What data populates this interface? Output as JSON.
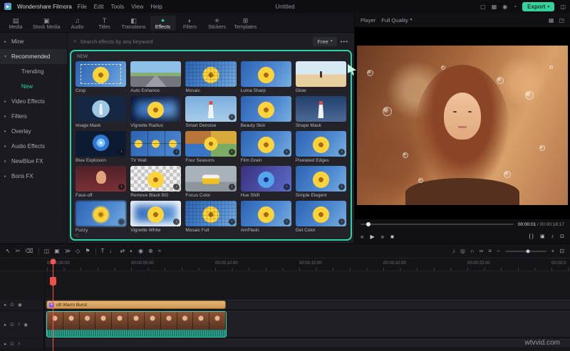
{
  "titlebar": {
    "app_name": "Wondershare Filmora",
    "menus": [
      "File",
      "Edit",
      "Tools",
      "View",
      "Help"
    ],
    "document_title": "Untitled",
    "right_icons": [
      {
        "name": "screen-recorder-icon",
        "glyph": "▢"
      },
      {
        "name": "layout-icon",
        "glyph": "▦"
      },
      {
        "name": "user-account-icon",
        "glyph": "◉"
      },
      {
        "name": "notification-icon",
        "glyph": "◔"
      }
    ],
    "export_label": "Export",
    "export_caret": "▾",
    "panel_toggle_icon": "◫",
    "logo_glyph": "▶"
  },
  "ribbon": {
    "tabs": [
      {
        "label": "Media",
        "icon": "▤",
        "active": false
      },
      {
        "label": "Stock Media",
        "icon": "▣",
        "active": false
      },
      {
        "label": "Audio",
        "icon": "♫",
        "active": false
      },
      {
        "label": "Titles",
        "icon": "T",
        "active": false
      },
      {
        "label": "Transitions",
        "icon": "◧",
        "active": false
      },
      {
        "label": "Effects",
        "icon": "✦",
        "active": true
      },
      {
        "label": "Filters",
        "icon": "◐",
        "active": false
      },
      {
        "label": "Stickers",
        "icon": "✳",
        "active": false
      },
      {
        "label": "Templates",
        "icon": "⊞",
        "active": false
      }
    ]
  },
  "sidebar": {
    "items": [
      {
        "label": "Mine",
        "level": 0,
        "chevron": "right",
        "active": false,
        "accent": false
      },
      {
        "label": "Recommended",
        "level": 0,
        "chevron": "down",
        "active": true,
        "accent": false
      },
      {
        "label": "Trending",
        "level": 1,
        "chevron": "none",
        "active": false,
        "accent": false
      },
      {
        "label": "New",
        "level": 1,
        "chevron": "none",
        "active": false,
        "accent": true
      },
      {
        "label": "Video Effects",
        "level": 0,
        "chevron": "right",
        "active": false,
        "accent": false
      },
      {
        "label": "Filters",
        "level": 0,
        "chevron": "right",
        "active": false,
        "accent": false
      },
      {
        "label": "Overlay",
        "level": 0,
        "chevron": "right",
        "active": false,
        "accent": false
      },
      {
        "label": "Audio Effects",
        "level": 0,
        "chevron": "right",
        "active": false,
        "accent": false
      },
      {
        "label": "NewBlue FX",
        "level": 0,
        "chevron": "right",
        "active": false,
        "accent": false
      },
      {
        "label": "Boris FX",
        "level": 0,
        "chevron": "right",
        "active": false,
        "accent": false
      }
    ]
  },
  "search": {
    "placeholder": "Search effects by any keyword",
    "filter_label": "Free",
    "more_label": "•••"
  },
  "effects": {
    "section_label": "NEW",
    "items": [
      {
        "label": "Crop",
        "visual": "crop",
        "badge": "none"
      },
      {
        "label": "Auto Enhance",
        "visual": "road",
        "badge": "none"
      },
      {
        "label": "Mosaic",
        "visual": "mosaic",
        "badge": "none"
      },
      {
        "label": "Luma Sharp",
        "visual": "flower",
        "badge": "none"
      },
      {
        "label": "Glow",
        "visual": "beach",
        "badge": "none"
      },
      {
        "label": "Image Mask",
        "visual": "mask",
        "badge": "none"
      },
      {
        "label": "Vignette Radius",
        "visual": "flower-vignette",
        "badge": "none"
      },
      {
        "label": "Smart Denoise",
        "visual": "lighthouse",
        "badge": "download"
      },
      {
        "label": "Beauty Skin",
        "visual": "flower",
        "badge": "none"
      },
      {
        "label": "Shape Mask",
        "visual": "lighthouse2",
        "badge": "none"
      },
      {
        "label": "Blue Explosion",
        "visual": "explosion",
        "badge": "download"
      },
      {
        "label": "TV Wall",
        "visual": "tvwall",
        "badge": "download"
      },
      {
        "label": "Four Seasons",
        "visual": "seasons",
        "badge": "download"
      },
      {
        "label": "Film Grain",
        "visual": "flower",
        "badge": "download"
      },
      {
        "label": "Pixelated Edges",
        "visual": "flower",
        "badge": "download"
      },
      {
        "label": "Face-off",
        "visual": "face",
        "badge": "download"
      },
      {
        "label": "Remove Black BG",
        "visual": "checker",
        "badge": "download"
      },
      {
        "label": "Focus Color",
        "visual": "bus",
        "badge": "download"
      },
      {
        "label": "Hue Shift",
        "visual": "hue",
        "badge": "download"
      },
      {
        "label": "Simple Elegent",
        "visual": "flower",
        "badge": "download"
      },
      {
        "label": "Fuzzy",
        "visual": "flower-blur",
        "badge": "download"
      },
      {
        "label": "Vignette White",
        "visual": "flower-white",
        "badge": "download"
      },
      {
        "label": "Mosaic Full",
        "visual": "mosaic",
        "badge": "download"
      },
      {
        "label": "AmPlash",
        "visual": "flower",
        "badge": "download"
      },
      {
        "label": "Get Color",
        "visual": "flower",
        "badge": "download"
      }
    ]
  },
  "player": {
    "label": "Player",
    "quality_label": "Full Quality",
    "quality_caret": "▾",
    "top_icons": [
      {
        "name": "grid-view-icon",
        "glyph": "▦"
      },
      {
        "name": "detach-window-icon",
        "glyph": "◳"
      }
    ],
    "current_time": "00:00:01",
    "time_separator": "/",
    "total_time": "00:00:18:17",
    "transport": [
      {
        "name": "previous-frame-button",
        "glyph": "«"
      },
      {
        "name": "play-button",
        "glyph": "▶"
      },
      {
        "name": "next-frame-button",
        "glyph": "»"
      },
      {
        "name": "stop-button",
        "glyph": "■"
      }
    ],
    "tools": [
      {
        "name": "mark-in-out-icon",
        "glyph": "{ }"
      },
      {
        "name": "snapshot-icon",
        "glyph": "▣"
      },
      {
        "name": "volume-icon",
        "glyph": "♪"
      },
      {
        "name": "fullscreen-icon",
        "glyph": "⊡"
      }
    ]
  },
  "timeline": {
    "tools_left": [
      {
        "name": "pointer-tool-icon",
        "glyph": "↖"
      },
      {
        "name": "razor-tool-icon",
        "glyph": "✂"
      },
      {
        "name": "delete-icon",
        "glyph": "⌫"
      },
      {
        "sep": true
      },
      {
        "name": "split-icon",
        "glyph": "◫"
      },
      {
        "name": "crop-icon",
        "glyph": "▣"
      },
      {
        "name": "speed-icon",
        "glyph": "≫"
      },
      {
        "name": "keyframe-icon",
        "glyph": "◇"
      },
      {
        "name": "marker-icon",
        "glyph": "⚑"
      },
      {
        "sep": true
      },
      {
        "name": "text-tool-icon",
        "glyph": "T"
      },
      {
        "name": "voiceover-icon",
        "glyph": "♩"
      },
      {
        "name": "transition-icon",
        "glyph": "⇄"
      },
      {
        "name": "chroma-key-icon",
        "glyph": "◐"
      },
      {
        "name": "snapshot-tool-icon",
        "glyph": "◉"
      },
      {
        "name": "motion-track-icon",
        "glyph": "⊕"
      },
      {
        "name": "stabilize-icon",
        "glyph": "≈"
      }
    ],
    "tools_right": [
      {
        "name": "mixer-icon",
        "glyph": "♪"
      },
      {
        "name": "record-icon",
        "glyph": "◎"
      },
      {
        "name": "magnet-icon",
        "glyph": "∩"
      },
      {
        "name": "link-icon",
        "glyph": "∞"
      },
      {
        "name": "manage-tracks-icon",
        "glyph": "≡"
      }
    ],
    "zoom": {
      "out": "−",
      "in": "+",
      "fit": "⊡"
    },
    "ruler_labels": [
      "00:00:00:00",
      "00:00:05:00",
      "00:00:10:00",
      "00:00:15:00",
      "00:00:20:00",
      "00:00:25:00",
      "00:00:3"
    ],
    "clip_label": "oft Warm Burst",
    "clip_badge_glyph": "✦",
    "video_clip_thumbs": 11,
    "track_headers": [
      {
        "track": "effect",
        "icons": [
          {
            "name": "track-options-icon",
            "glyph": "▸"
          },
          {
            "name": "lock-icon",
            "glyph": "∅"
          },
          {
            "name": "eye-icon",
            "glyph": "◉"
          }
        ]
      },
      {
        "track": "video",
        "icons": [
          {
            "name": "track-options-icon",
            "glyph": "▸"
          },
          {
            "name": "lock-icon",
            "glyph": "∅"
          },
          {
            "name": "mute-icon",
            "glyph": "♪"
          },
          {
            "name": "eye-icon",
            "glyph": "◉"
          }
        ]
      },
      {
        "track": "audio",
        "icons": [
          {
            "name": "track-options-icon",
            "glyph": "▸"
          },
          {
            "name": "lock-icon",
            "glyph": "∅"
          },
          {
            "name": "mute-icon",
            "glyph": "♪"
          }
        ]
      }
    ]
  },
  "watermark": "wtvvid.com"
}
